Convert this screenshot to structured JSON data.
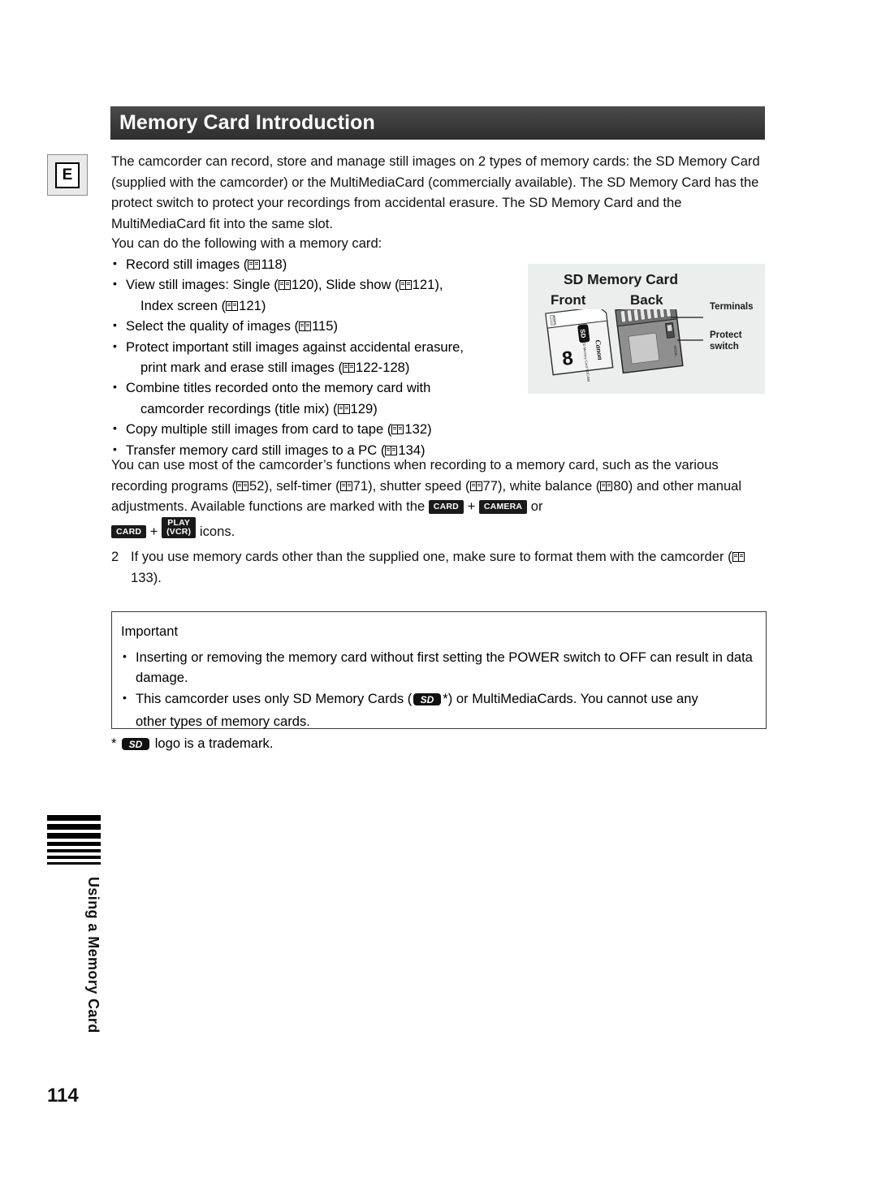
{
  "header": {
    "title": "Memory Card Introduction"
  },
  "lang_tab": "E",
  "intro": {
    "paragraph1": "The camcorder can record, store and manage still images on 2 types of memory cards: the SD Memory Card (supplied with the camcorder) or the MultiMediaCard (commercially available). The SD Memory Card has the protect switch to protect your recordings from accidental erasure. The SD Memory Card and the MultiMediaCard fit into the same slot.",
    "paragraph2": "You can do the following with a memory card:"
  },
  "bullets": [
    {
      "pre": "Record still images (",
      "ref": "118",
      "post": ")"
    },
    {
      "pre": "View still images: Single (",
      "ref": "120",
      "mid": "), Slide show (",
      "ref2": "121",
      "post": "),",
      "sub_pre": "Index screen (",
      "sub_ref": "121",
      "sub_post": ")"
    },
    {
      "pre": "Select the quality of images (",
      "ref": "115",
      "post": ")"
    },
    {
      "pre": "Protect important still images against accidental erasure,",
      "sub_pre": "print mark and erase still images (",
      "sub_ref": "122-128",
      "sub_post": ")"
    },
    {
      "pre": "Combine titles recorded onto the memory card with",
      "sub_pre": "camcorder recordings (title mix) (",
      "sub_ref": "129",
      "sub_post": ")"
    },
    {
      "pre": "Copy multiple still images from card to tape (",
      "ref": "132",
      "post": ")"
    },
    {
      "pre": "Transfer memory card still images to a PC (",
      "ref": "134",
      "post": ")"
    }
  ],
  "sd_panel": {
    "title": "SD Memory Card",
    "front_label": "Front",
    "back_label": "Back",
    "terminals_label": "Terminals",
    "protect_label_line1": "Protect",
    "protect_label_line2": "switch",
    "card_brand": "Canon",
    "card_capacity": "8",
    "card_sub": "SD Memory Card SDC-8M"
  },
  "functions_paragraph": {
    "part1": "You can use most of the camcorder’s functions when recording to a memory card, such as the various recording programs (",
    "ref1": "52",
    "part2": "), self-timer (",
    "ref2": "71",
    "part3": "), shutter speed (",
    "ref3": "77",
    "part4": "), white balance (",
    "ref4": "80",
    "part5": ") and other manual adjustments. Available functions are marked with the",
    "chip_card": "CARD",
    "plus": "+",
    "chip_camera": "CAMERA",
    "or": "or",
    "chip_card2": "CARD",
    "plus2": "+",
    "chip_play_line1": "PLAY",
    "chip_play_line2": "(VCR)",
    "part6": "icons."
  },
  "note": {
    "number": "2",
    "text_pre": "If you use memory cards other than the supplied one, make sure to format them with the camcorder (",
    "ref": "133",
    "text_post": ")."
  },
  "important": {
    "title": "Important",
    "items": [
      "Inserting or removing the memory card without first setting the POWER switch to OFF can result in data damage.",
      "This camcorder uses only SD Memory Cards (      *) or MultiMediaCards. You cannot use any other types of memory cards."
    ],
    "item2_pre": "This camcorder uses only SD Memory Cards (",
    "item2_post": "*) or MultiMediaCards. You cannot use any",
    "item2_line2": "other types of memory cards."
  },
  "footnote": {
    "star": "*",
    "text": "logo is a trademark."
  },
  "side_tab": {
    "label": "Using a Memory Card"
  },
  "page_number": "114",
  "colors": {
    "header_bar": "#3b3b3b",
    "panel_bg": "#eceded",
    "text": "#111111"
  }
}
